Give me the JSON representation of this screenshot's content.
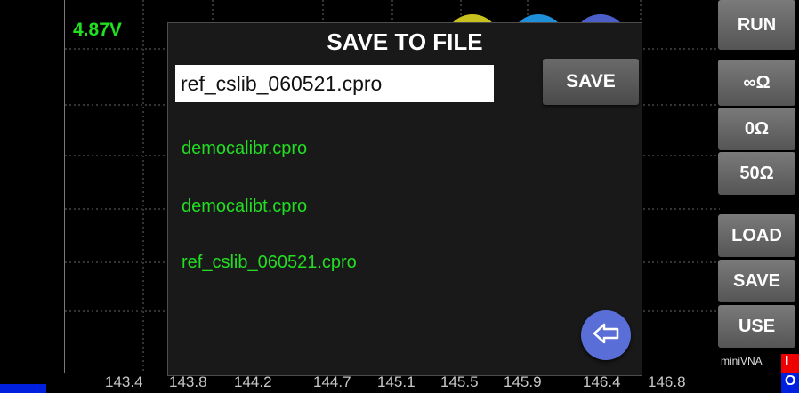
{
  "status": {
    "voltage": "4.87V"
  },
  "x_axis": {
    "ticks": [
      "143.4",
      "143.8",
      "144.2",
      "144.7",
      "145.1",
      "145.5",
      "145.9",
      "146.4",
      "146.8"
    ]
  },
  "dialog": {
    "title": "SAVE TO FILE",
    "filename_value": "ref_cslib_060521.cpro",
    "save_label": "SAVE",
    "files": [
      "democalibr.cpro",
      "democalibt.cpro",
      "ref_cslib_060521.cpro"
    ]
  },
  "side_buttons": {
    "run": "RUN",
    "open": "∞Ω",
    "short": "0Ω",
    "load50": "50Ω",
    "load": "LOAD",
    "save": "SAVE",
    "use": "USE"
  },
  "brand": "miniVNA",
  "markers": {
    "red": "I",
    "blue": "O"
  },
  "colors": {
    "accent_green": "#22dd22",
    "fab_blue": "#5a6ed8",
    "marker_red": "#ee0000",
    "marker_blue": "#0020e0"
  },
  "icons": {
    "back": "arrow-left-icon",
    "bg1": "yellow-circle-icon",
    "bg2": "globe-icon",
    "bg3": "camera-icon"
  }
}
